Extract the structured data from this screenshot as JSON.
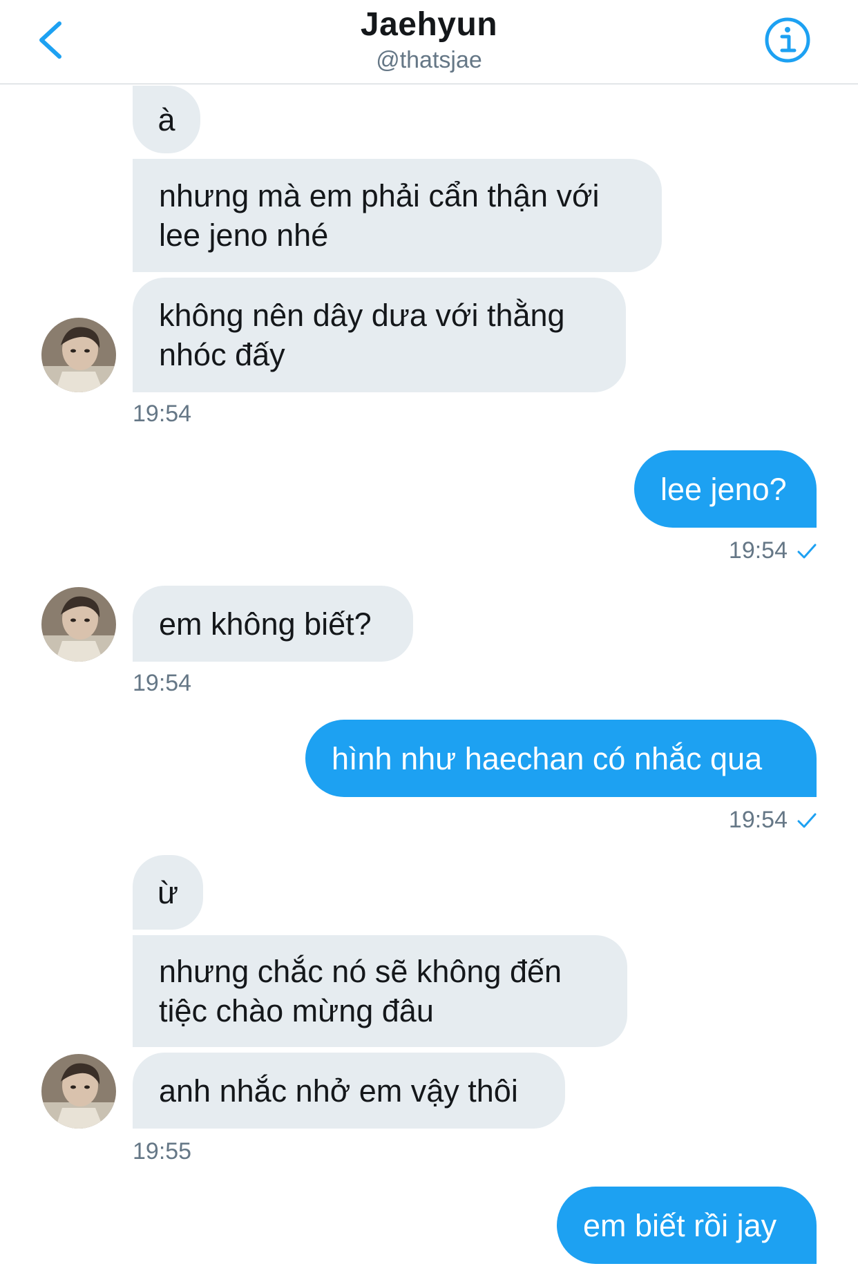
{
  "header": {
    "name": "Jaehyun",
    "handle": "@thatsjae",
    "accent": "#1da1f2"
  },
  "messages": [
    {
      "side": "in",
      "text": "à"
    },
    {
      "side": "in",
      "text": "nhưng mà em phải cẩn thận với lee jeno nhé"
    },
    {
      "side": "in",
      "text": "không nên dây dưa với thằng nhóc đấy"
    },
    {
      "time": "19:54"
    },
    {
      "side": "out",
      "text": "lee jeno?"
    },
    {
      "time": "19:54",
      "status": "sent-check-icon"
    },
    {
      "side": "in",
      "text": "em không biết?"
    },
    {
      "time": "19:54"
    },
    {
      "side": "out",
      "text": "hình như haechan có nhắc qua"
    },
    {
      "time": "19:54",
      "status": "sent-check-icon"
    },
    {
      "side": "in",
      "text": "ừ"
    },
    {
      "side": "in",
      "text": "nhưng chắc nó sẽ không đến tiệc chào mừng đâu"
    },
    {
      "side": "in",
      "text": "anh nhắc nhở em vậy thôi"
    },
    {
      "time": "19:55"
    },
    {
      "side": "out",
      "text": "em biết rồi jay"
    }
  ],
  "colors": {
    "incoming_bubble": "#e6ecf0",
    "outgoing_bubble": "#1da1f2",
    "timestamp": "#657786"
  }
}
